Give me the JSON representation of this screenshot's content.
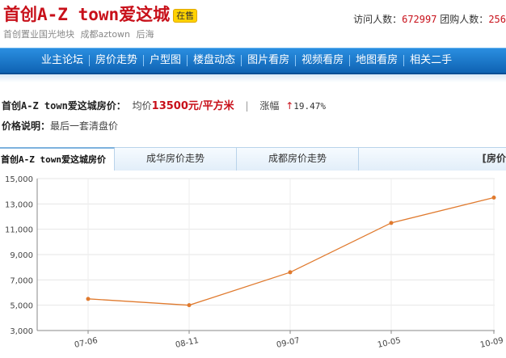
{
  "header": {
    "title": "首创A-Z town爱这城",
    "badge": "在售",
    "subtitle_parts": [
      "首创置业国光地块",
      "成都aztown",
      "后海"
    ],
    "visitors_label": "访问人数：",
    "visitors_value": "672997",
    "group_label": "团购人数：",
    "group_value": "256"
  },
  "nav": {
    "items": [
      "业主论坛",
      "房价走势",
      "户型图",
      "楼盘动态",
      "图片看房",
      "视频看房",
      "地图看房",
      "相关二手"
    ]
  },
  "price": {
    "name": "首创A-Z town爱这城房价：",
    "avg_label": "均价",
    "avg_value": "13500元/平方米",
    "divider": "|",
    "change_label": "涨幅",
    "change_arrow": "↑",
    "change_value": "19.47%",
    "note_label": "价格说明：",
    "note_value": "最后一套清盘价"
  },
  "tabs": [
    {
      "label": "首创A-Z town爱这城房价",
      "active": true
    },
    {
      "label": "成华房价走势",
      "active": false
    },
    {
      "label": "成都房价走势",
      "active": false
    },
    {
      "label": "[房价",
      "active": false
    }
  ],
  "colors": {
    "brand_red": "#c8101a",
    "nav_blue": "#1a76cc",
    "line": "#e07a2e"
  },
  "chart_data": {
    "type": "line",
    "x": [
      "07-06",
      "08-11",
      "09-07",
      "10-05",
      "10-09"
    ],
    "series": [
      {
        "values": [
          5500,
          5000,
          7600,
          11500,
          13500
        ]
      }
    ],
    "yticks": [
      "3,000",
      "5,000",
      "7,000",
      "9,000",
      "11,000",
      "13,000",
      "15,000"
    ],
    "ylim": [
      3000,
      15000
    ],
    "grid": true
  }
}
